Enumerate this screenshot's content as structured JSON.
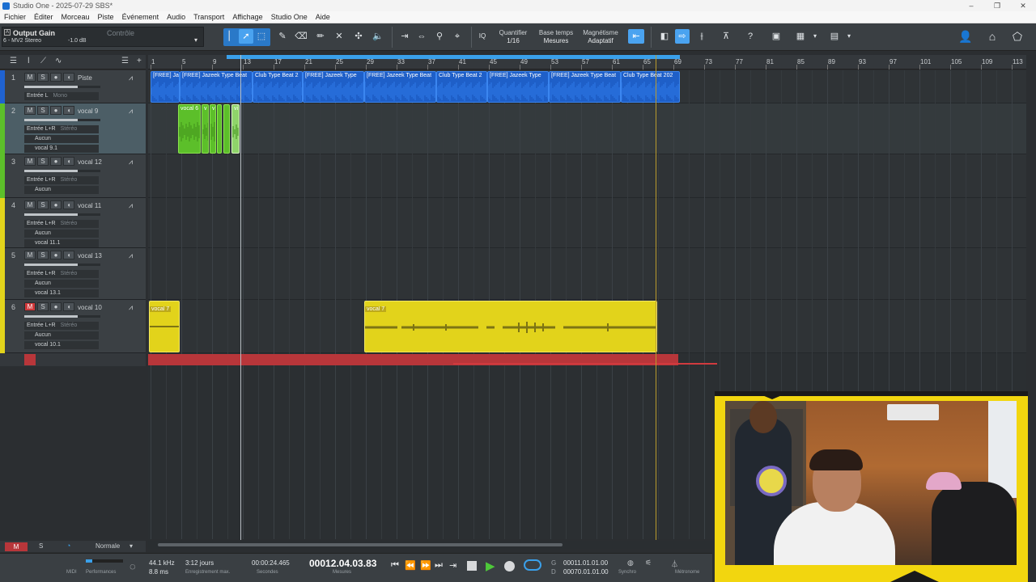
{
  "window": {
    "title": "Studio One - 2025-07-29 SBS*",
    "controls": [
      "–",
      "❐",
      "✕"
    ]
  },
  "menu": [
    "Fichier",
    "Éditer",
    "Morceau",
    "Piste",
    "Événement",
    "Audio",
    "Transport",
    "Affichage",
    "Studio One",
    "Aide"
  ],
  "output_gain": {
    "title": "Output Gain",
    "control": "Contrôle",
    "channel": "6 - MV2 Stereo",
    "db": "-1.0 dB"
  },
  "toolbar": {
    "quantize_label": "Quantifier",
    "quantize_value": "1/16",
    "timebase_label": "Base temps",
    "timebase_value": "Mesures",
    "snap_label": "Magnétisme",
    "snap_value": "Adaptatif",
    "iq": "IQ"
  },
  "ruler": [
    "1",
    "5",
    "9",
    "13",
    "17",
    "21",
    "25",
    "29",
    "33",
    "37",
    "41",
    "45",
    "49",
    "53",
    "57",
    "61",
    "65",
    "69",
    "73",
    "77",
    "81",
    "85",
    "89",
    "93",
    "97",
    "101",
    "105",
    "109",
    "113"
  ],
  "tracks": [
    {
      "num": "1",
      "name": "Piste",
      "input": "Entrée L",
      "mode": "Mono",
      "color": "#1f62d0",
      "mute": false
    },
    {
      "num": "2",
      "name": "vocal 9",
      "input": "Entrée L+R",
      "mode": "Stéréo",
      "out": "Aucun",
      "layer": "vocal 9.1",
      "color": "#5cbf2a",
      "mute": false
    },
    {
      "num": "3",
      "name": "vocal 12",
      "input": "Entrée L+R",
      "mode": "Stéréo",
      "out": "Aucun",
      "color": "#5cbf2a",
      "mute": false
    },
    {
      "num": "4",
      "name": "vocal 11",
      "input": "Entrée L+R",
      "mode": "Stéréo",
      "out": "Aucun",
      "layer": "vocal 11.1",
      "color": "#e2d31b",
      "mute": false
    },
    {
      "num": "5",
      "name": "vocal 13",
      "input": "Entrée L+R",
      "mode": "Stéréo",
      "out": "Aucun",
      "layer": "vocal 13.1",
      "color": "#e2d31b",
      "mute": false
    },
    {
      "num": "6",
      "name": "vocal 10",
      "input": "Entrée L+R",
      "mode": "Stéréo",
      "out": "Aucun",
      "layer": "vocal 10.1",
      "color": "#e2d31b",
      "mute": true
    }
  ],
  "track_buttons": {
    "m": "M",
    "s": "S"
  },
  "clips": {
    "track1": [
      "[FREE] Ja",
      "[FREE] Jazeek Type Beat",
      "Club Type Beat 2",
      "[FREE] Jazeek Type",
      "[FREE] Jazeek Type Beat",
      "Club Type Beat 2",
      "[FREE] Jazeek Type",
      "[FREE] Jazeek Type Beat",
      "Club Type Beat 202"
    ],
    "track2": [
      "vocal 6",
      "v",
      "v",
      "vi"
    ],
    "track6": [
      "vocal 7",
      "vocal 7"
    ]
  },
  "footer": {
    "m": "M",
    "s": "S",
    "mode": "Normale"
  },
  "transport": {
    "midi": "MIDI",
    "perf": "Performances",
    "samplerate": "44.1 kHz",
    "latency": "8.8 ms",
    "days": "3:12 jours",
    "record_max": "Enregistrement max.",
    "seconds_value": "00:00:24.465",
    "seconds_label": "Secondes",
    "bars_value": "00012.04.03.83",
    "bars_label": "Mesures",
    "loop_start": "00011.01.01.00",
    "loop_end": "00070.01.01.00",
    "g": "G",
    "d": "D",
    "sync": "Synchro",
    "metronome": "Métronome"
  }
}
